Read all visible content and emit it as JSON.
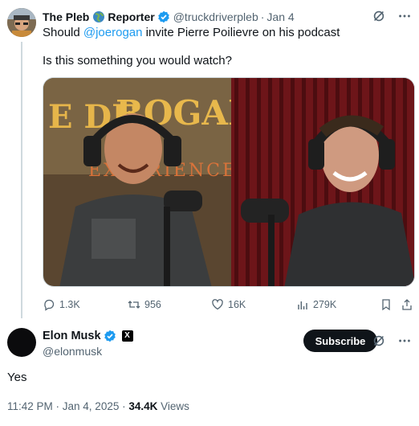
{
  "tweet": {
    "author_name": "The Pleb",
    "author_name_suffix": "Reporter",
    "handle": "@truckdriverpleb",
    "separator": "·",
    "date": "Jan 4",
    "text_before": "Should ",
    "mention": "@joerogan",
    "text_after": " invite Pierre Poilievre on his podcast",
    "line2": "Is this something you would watch?",
    "media": {
      "left_banner": "ROGAN",
      "left_banner_sub": "EXPERIENCE",
      "left_banner_letters": "E DE"
    },
    "actions": {
      "replies": "1.3K",
      "reposts": "956",
      "likes": "16K",
      "views": "279K"
    }
  },
  "reply": {
    "author_name": "Elon Musk",
    "handle": "@elonmusk",
    "x_badge": "X",
    "subscribe_label": "Subscribe",
    "text": "Yes",
    "timestamp": "11:42 PM · Jan 4, 2025 · ",
    "views_count": "34.4K",
    "views_label": " Views"
  },
  "colors": {
    "accent": "#1d9bf0",
    "text": "#0f1419",
    "muted": "#536471"
  }
}
